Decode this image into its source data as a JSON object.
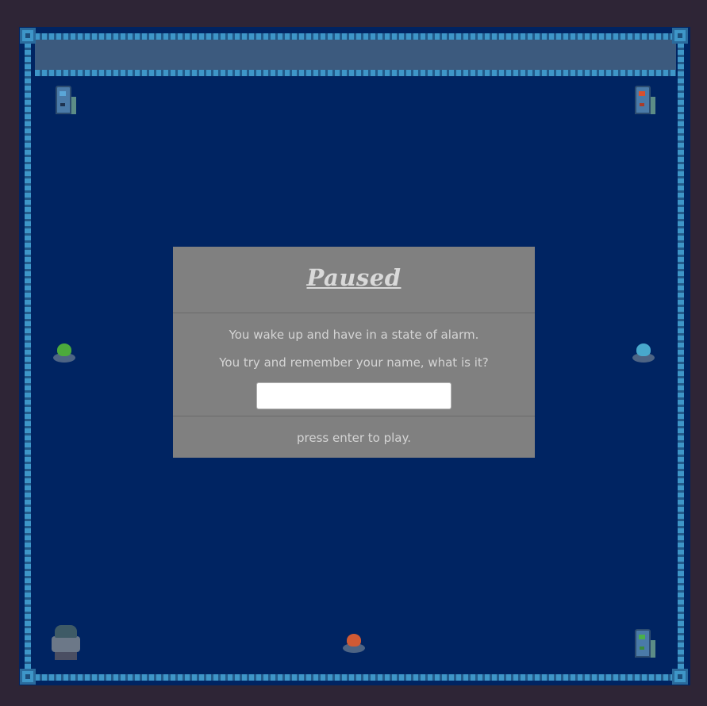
{
  "dialog": {
    "title": "Paused",
    "message_line_1": "You wake up and have in a state of alarm.",
    "message_line_2": "You try and remember your name, what is it?",
    "name_input_value": "",
    "footer": "press enter to play."
  },
  "colors": {
    "room_floor": "#002462",
    "wall_pipe": "#3e96c8",
    "dialog_background": "#808080",
    "outer_background": "#2e2536"
  },
  "sprites": [
    {
      "name": "locker-terminal",
      "light": "blue"
    },
    {
      "name": "locker-terminal",
      "light": "red"
    },
    {
      "name": "orb-green"
    },
    {
      "name": "orb-cyan"
    },
    {
      "name": "robot-player"
    },
    {
      "name": "orb-red"
    },
    {
      "name": "locker-terminal",
      "light": "green"
    }
  ]
}
